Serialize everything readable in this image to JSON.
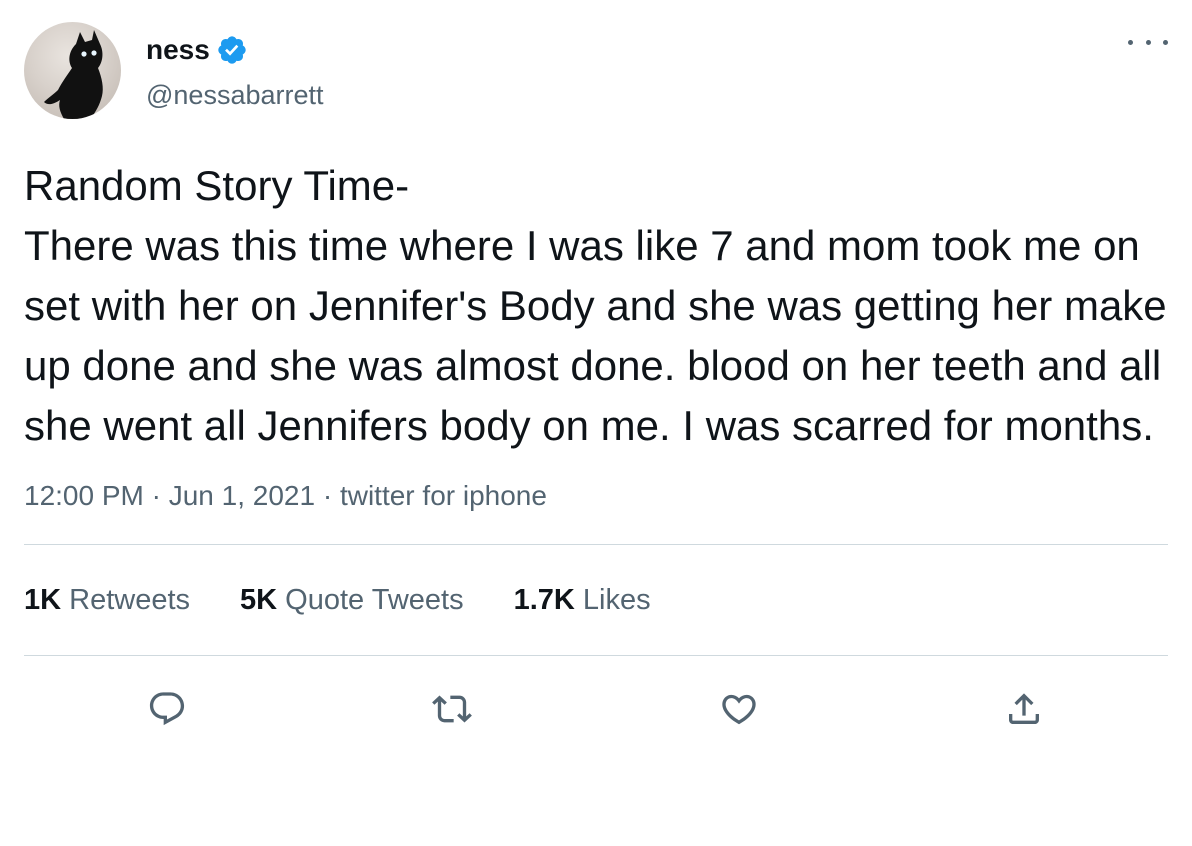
{
  "tweet": {
    "display_name": "ness",
    "handle": "@nessabarrett",
    "text": "Random Story Time-\nThere was this time where I was like 7 and mom took me on set with her on Jennifer's Body and she was getting her make up done and she was almost done. blood on her teeth and all she went all Jennifers body on me. I was scarred for months.",
    "meta": "12:00 PM · Jun 1, 2021 · twitter for iphone"
  },
  "stats": [
    {
      "count": "1K",
      "label": "Retweets"
    },
    {
      "count": "5K",
      "label": "Quote Tweets"
    },
    {
      "count": "1.7K",
      "label": "Likes"
    }
  ],
  "icons": {
    "verified": "verified-badge-icon",
    "more": "more-options-icon",
    "reply": "reply-icon",
    "retweet": "retweet-icon",
    "like": "heart-icon",
    "share": "share-icon"
  },
  "colors": {
    "primary_text": "#0f1419",
    "secondary_text": "#536471",
    "verified_blue": "#1d9bf0",
    "divider": "#cfd9de"
  }
}
